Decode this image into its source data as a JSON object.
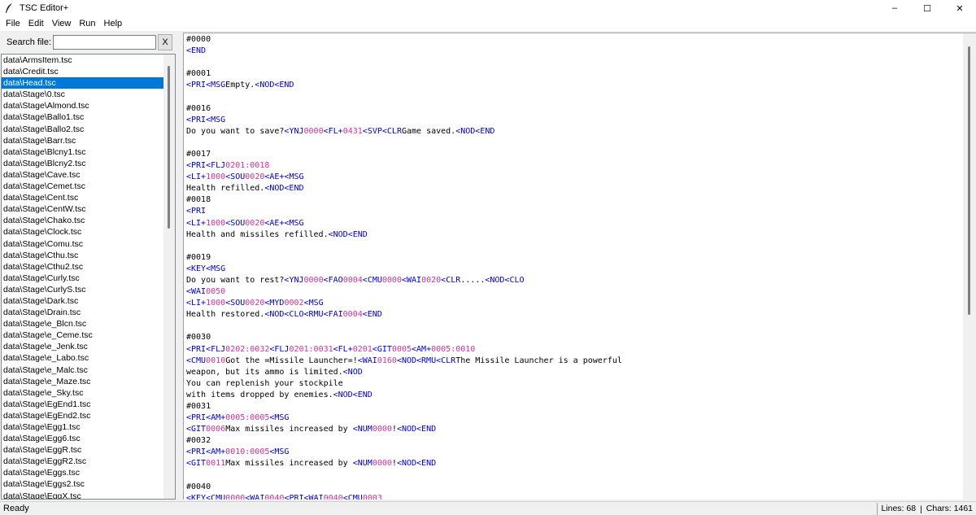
{
  "window": {
    "title": "TSC Editor+",
    "icon": "feather-icon",
    "controls": {
      "minimize": "–",
      "maximize": "☐",
      "close": "✕"
    }
  },
  "menu": [
    "File",
    "Edit",
    "View",
    "Run",
    "Help"
  ],
  "search": {
    "label": "Search file:",
    "value": "",
    "placeholder": "",
    "clear_label": "X"
  },
  "files": {
    "selected": "data\\Head.tsc",
    "items": [
      "data\\ArmsItem.tsc",
      "data\\Credit.tsc",
      "data\\Head.tsc",
      "data\\Stage\\0.tsc",
      "data\\Stage\\Almond.tsc",
      "data\\Stage\\Ballo1.tsc",
      "data\\Stage\\Ballo2.tsc",
      "data\\Stage\\Barr.tsc",
      "data\\Stage\\Blcny1.tsc",
      "data\\Stage\\Blcny2.tsc",
      "data\\Stage\\Cave.tsc",
      "data\\Stage\\Cemet.tsc",
      "data\\Stage\\Cent.tsc",
      "data\\Stage\\CentW.tsc",
      "data\\Stage\\Chako.tsc",
      "data\\Stage\\Clock.tsc",
      "data\\Stage\\Comu.tsc",
      "data\\Stage\\Cthu.tsc",
      "data\\Stage\\Cthu2.tsc",
      "data\\Stage\\Curly.tsc",
      "data\\Stage\\CurlyS.tsc",
      "data\\Stage\\Dark.tsc",
      "data\\Stage\\Drain.tsc",
      "data\\Stage\\e_Blcn.tsc",
      "data\\Stage\\e_Ceme.tsc",
      "data\\Stage\\e_Jenk.tsc",
      "data\\Stage\\e_Labo.tsc",
      "data\\Stage\\e_Malc.tsc",
      "data\\Stage\\e_Maze.tsc",
      "data\\Stage\\e_Sky.tsc",
      "data\\Stage\\EgEnd1.tsc",
      "data\\Stage\\EgEnd2.tsc",
      "data\\Stage\\Egg1.tsc",
      "data\\Stage\\Egg6.tsc",
      "data\\Stage\\EggR.tsc",
      "data\\Stage\\EggR2.tsc",
      "data\\Stage\\Eggs.tsc",
      "data\\Stage\\Eggs2.tsc",
      "data\\Stage\\EggX.tsc"
    ]
  },
  "editor": {
    "colors": {
      "command": "#0000cc",
      "number": "#cc3399",
      "text": "#000000"
    },
    "lines": [
      [
        [
          "t",
          "#0000"
        ]
      ],
      [
        [
          "c",
          "<END"
        ]
      ],
      [],
      [
        [
          "t",
          "#0001"
        ]
      ],
      [
        [
          "c",
          "<PRI<MSG"
        ],
        [
          "t",
          "Empty."
        ],
        [
          "c",
          "<NOD<END"
        ]
      ],
      [],
      [
        [
          "t",
          "#0016"
        ]
      ],
      [
        [
          "c",
          "<PRI<MSG"
        ]
      ],
      [
        [
          "t",
          "Do you want to save?"
        ],
        [
          "c",
          "<YNJ"
        ],
        [
          "n",
          "0000"
        ],
        [
          "c",
          "<FL+"
        ],
        [
          "n",
          "0431"
        ],
        [
          "c",
          "<SVP<CLR"
        ],
        [
          "t",
          "Game saved."
        ],
        [
          "c",
          "<NOD<END"
        ]
      ],
      [],
      [
        [
          "t",
          "#0017"
        ]
      ],
      [
        [
          "c",
          "<PRI<FLJ"
        ],
        [
          "n",
          "0201:0018"
        ]
      ],
      [
        [
          "c",
          "<LI+"
        ],
        [
          "n",
          "1000"
        ],
        [
          "c",
          "<SOU"
        ],
        [
          "n",
          "0020"
        ],
        [
          "c",
          "<AE+<MSG"
        ]
      ],
      [
        [
          "t",
          "Health refilled."
        ],
        [
          "c",
          "<NOD<END"
        ]
      ],
      [
        [
          "t",
          "#0018"
        ]
      ],
      [
        [
          "c",
          "<PRI"
        ]
      ],
      [
        [
          "c",
          "<LI+"
        ],
        [
          "n",
          "1000"
        ],
        [
          "c",
          "<SOU"
        ],
        [
          "n",
          "0020"
        ],
        [
          "c",
          "<AE+<MSG"
        ]
      ],
      [
        [
          "t",
          "Health and missiles refilled."
        ],
        [
          "c",
          "<NOD<END"
        ]
      ],
      [],
      [
        [
          "t",
          "#0019"
        ]
      ],
      [
        [
          "c",
          "<KEY<MSG"
        ]
      ],
      [
        [
          "t",
          "Do you want to rest?"
        ],
        [
          "c",
          "<YNJ"
        ],
        [
          "n",
          "0000"
        ],
        [
          "c",
          "<FAO"
        ],
        [
          "n",
          "0004"
        ],
        [
          "c",
          "<CMU"
        ],
        [
          "n",
          "0000"
        ],
        [
          "c",
          "<WAI"
        ],
        [
          "n",
          "0020"
        ],
        [
          "c",
          "<CLR"
        ],
        [
          "t",
          "....."
        ],
        [
          "c",
          "<NOD<CLO"
        ]
      ],
      [
        [
          "c",
          "<WAI"
        ],
        [
          "n",
          "0050"
        ]
      ],
      [
        [
          "c",
          "<LI+"
        ],
        [
          "n",
          "1000"
        ],
        [
          "c",
          "<SOU"
        ],
        [
          "n",
          "0020"
        ],
        [
          "c",
          "<MYD"
        ],
        [
          "n",
          "0002"
        ],
        [
          "c",
          "<MSG"
        ]
      ],
      [
        [
          "t",
          "Health restored."
        ],
        [
          "c",
          "<NOD<CLO<RMU<FAI"
        ],
        [
          "n",
          "0004"
        ],
        [
          "c",
          "<END"
        ]
      ],
      [],
      [
        [
          "t",
          "#0030"
        ]
      ],
      [
        [
          "c",
          "<PRI<FLJ"
        ],
        [
          "n",
          "0202:0032"
        ],
        [
          "c",
          "<FLJ"
        ],
        [
          "n",
          "0201:0031"
        ],
        [
          "c",
          "<FL+"
        ],
        [
          "n",
          "0201"
        ],
        [
          "c",
          "<GIT"
        ],
        [
          "n",
          "0005"
        ],
        [
          "c",
          "<AM+"
        ],
        [
          "n",
          "0005:0010"
        ]
      ],
      [
        [
          "c",
          "<CMU"
        ],
        [
          "n",
          "0010"
        ],
        [
          "t",
          "Got the =Missile Launcher=!"
        ],
        [
          "c",
          "<WAI"
        ],
        [
          "n",
          "0160"
        ],
        [
          "c",
          "<NOD<RMU<CLR"
        ],
        [
          "t",
          "The Missile Launcher is a powerful"
        ]
      ],
      [
        [
          "t",
          "weapon, but its ammo is limited."
        ],
        [
          "c",
          "<NOD"
        ]
      ],
      [
        [
          "t",
          "You can replenish your stockpile"
        ]
      ],
      [
        [
          "t",
          "with items dropped by enemies."
        ],
        [
          "c",
          "<NOD<END"
        ]
      ],
      [
        [
          "t",
          "#0031"
        ]
      ],
      [
        [
          "c",
          "<PRI<AM+"
        ],
        [
          "n",
          "0005:0005"
        ],
        [
          "c",
          "<MSG"
        ]
      ],
      [
        [
          "c",
          "<GIT"
        ],
        [
          "n",
          "0006"
        ],
        [
          "t",
          "Max missiles increased by "
        ],
        [
          "c",
          "<NUM"
        ],
        [
          "n",
          "0000"
        ],
        [
          "t",
          "!"
        ],
        [
          "c",
          "<NOD<END"
        ]
      ],
      [
        [
          "t",
          "#0032"
        ]
      ],
      [
        [
          "c",
          "<PRI<AM+"
        ],
        [
          "n",
          "0010:0005"
        ],
        [
          "c",
          "<MSG"
        ]
      ],
      [
        [
          "c",
          "<GIT"
        ],
        [
          "n",
          "0011"
        ],
        [
          "t",
          "Max missiles increased by "
        ],
        [
          "c",
          "<NUM"
        ],
        [
          "n",
          "0000"
        ],
        [
          "t",
          "!"
        ],
        [
          "c",
          "<NOD<END"
        ]
      ],
      [],
      [
        [
          "t",
          "#0040"
        ]
      ],
      [
        [
          "c",
          "<KEY<CMU"
        ],
        [
          "n",
          "0000"
        ],
        [
          "c",
          "<WAI"
        ],
        [
          "n",
          "0040"
        ],
        [
          "c",
          "<PRI<WAI"
        ],
        [
          "n",
          "0040"
        ],
        [
          "c",
          "<CMU"
        ],
        [
          "n",
          "0003"
        ]
      ]
    ]
  },
  "status": {
    "text": "Ready",
    "lines": "Lines: 68",
    "separator": "|",
    "chars": "Chars: 1461"
  }
}
